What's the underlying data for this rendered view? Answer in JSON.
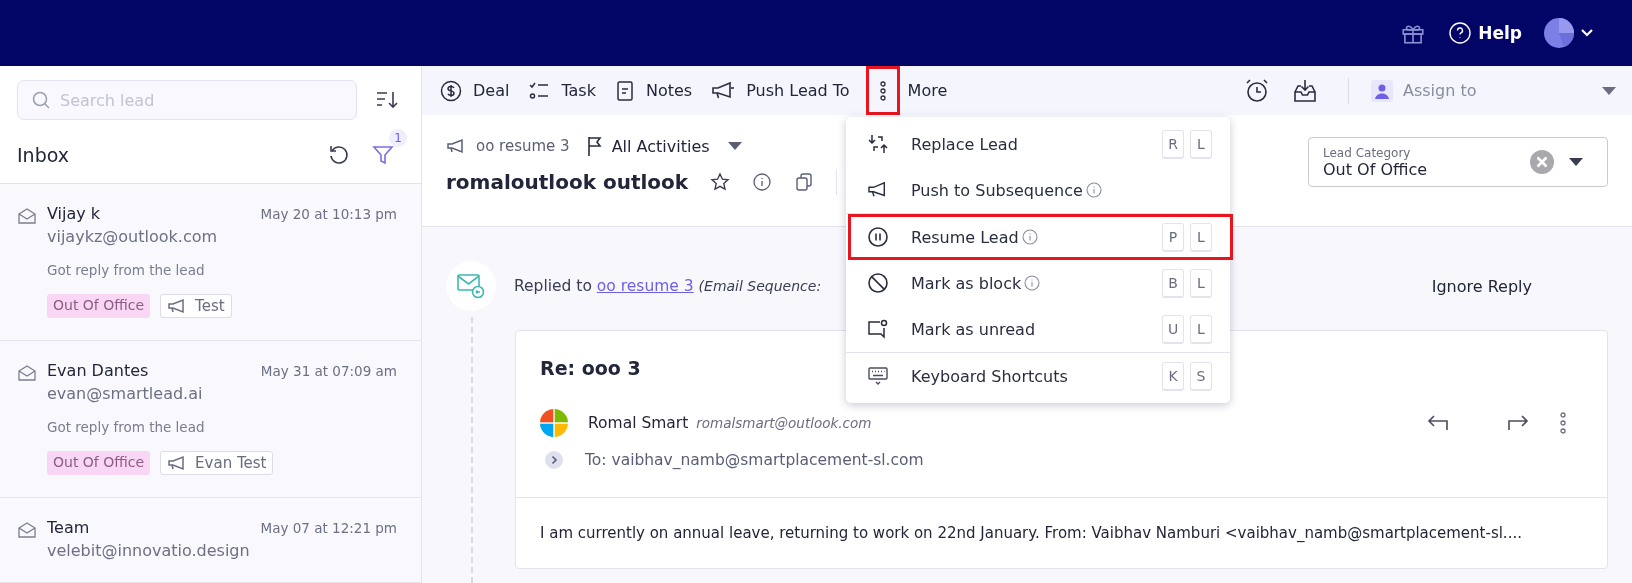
{
  "top_bar": {
    "help": "Help"
  },
  "sidebar": {
    "search": {
      "placeholder": "Search lead"
    },
    "title": "Inbox",
    "filter_count": "1",
    "leads": [
      {
        "name": "Vijay k",
        "email": "vijaykz@outlook.com",
        "time": "May 20 at 10:13 pm",
        "preview": "Got reply from the lead",
        "category": "Out Of Office",
        "campaign": "Test"
      },
      {
        "name": "Evan Dantes",
        "email": "evan@smartlead.ai",
        "time": "May 31 at 07:09 am",
        "preview": "Got reply from the lead",
        "category": "Out Of Office",
        "campaign": "Evan Test"
      },
      {
        "name": "Team",
        "email": "velebit@innovatio.design",
        "time": "May 07 at 12:21 pm"
      }
    ]
  },
  "toolbar": {
    "items": [
      {
        "label": "Deal",
        "highlighted": false
      },
      {
        "label": "Task",
        "highlighted": false
      },
      {
        "label": "Notes",
        "highlighted": false
      },
      {
        "label": "Push Lead To",
        "highlighted": false
      },
      {
        "label": "More",
        "highlighted": true
      }
    ],
    "assign": "Assign to"
  },
  "header": {
    "campaign": "oo resume 3",
    "activities": "All Activities",
    "lead_name": "romaloutlook outlook",
    "lead_category": {
      "label": "Lead Category",
      "value": "Out Of Office"
    }
  },
  "menu": {
    "groups": [
      [
        {
          "label": "Replace Lead",
          "info": false,
          "keys": [
            "R",
            "L"
          ],
          "highlighted": false
        },
        {
          "label": "Push to Subsequence",
          "info": true,
          "highlighted": false
        }
      ],
      [
        {
          "label": "Resume Lead",
          "info": true,
          "keys": [
            "P",
            "L"
          ],
          "highlighted": true
        },
        {
          "label": "Mark as block",
          "info": true,
          "keys": [
            "B",
            "L"
          ],
          "highlighted": false
        },
        {
          "label": "Mark as unread",
          "info": false,
          "keys": [
            "U",
            "L"
          ],
          "highlighted": false
        }
      ],
      [
        {
          "label": "Keyboard Shortcuts",
          "info": false,
          "keys": [
            "K",
            "S"
          ],
          "highlighted": false
        }
      ]
    ]
  },
  "timeline": {
    "event": {
      "prefix": "Replied to",
      "link": "oo resume 3",
      "suffix": "(Email Sequence:"
    },
    "ignore": "Ignore Reply",
    "email": {
      "subject": "Re: ooo 3",
      "sender": "Romal Smart",
      "sender_email": "romalsmart@outlook.com",
      "to": "To: vaibhav_namb@smartplacement-sl.com",
      "body": "I am currently on annual leave, returning to work on 22nd January. From: Vaibhav Namburi <vaibhav_namb@smartplacement-sl...."
    }
  }
}
